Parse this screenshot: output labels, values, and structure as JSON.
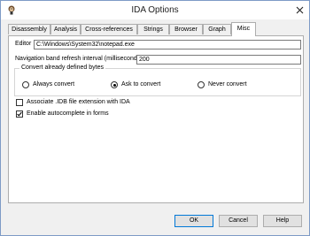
{
  "window": {
    "title": "IDA Options"
  },
  "tabs": [
    {
      "label": "Disassembly"
    },
    {
      "label": "Analysis"
    },
    {
      "label": "Cross-references"
    },
    {
      "label": "Strings"
    },
    {
      "label": "Browser"
    },
    {
      "label": "Graph"
    },
    {
      "label": "Misc",
      "active": true
    }
  ],
  "misc": {
    "editor_label": "Editor",
    "editor_value": "C:\\Windows\\System32\\notepad.exe",
    "refresh_label": "Navigation band refresh interval (milliseconds)",
    "refresh_value": "200",
    "convert_group_title": "Convert already defined bytes",
    "convert_options": [
      {
        "label": "Always convert",
        "checked": false
      },
      {
        "label": "Ask to convert",
        "checked": true
      },
      {
        "label": "Never convert",
        "checked": false
      }
    ],
    "associate_label": "Associate .IDB file extension with IDA",
    "associate_checked": false,
    "autocomplete_label": "Enable autocomplete in forms",
    "autocomplete_checked": true
  },
  "buttons": {
    "ok": "OK",
    "cancel": "Cancel",
    "help": "Help"
  },
  "icons": {
    "app": "ida-app-icon",
    "close": "close-icon"
  }
}
